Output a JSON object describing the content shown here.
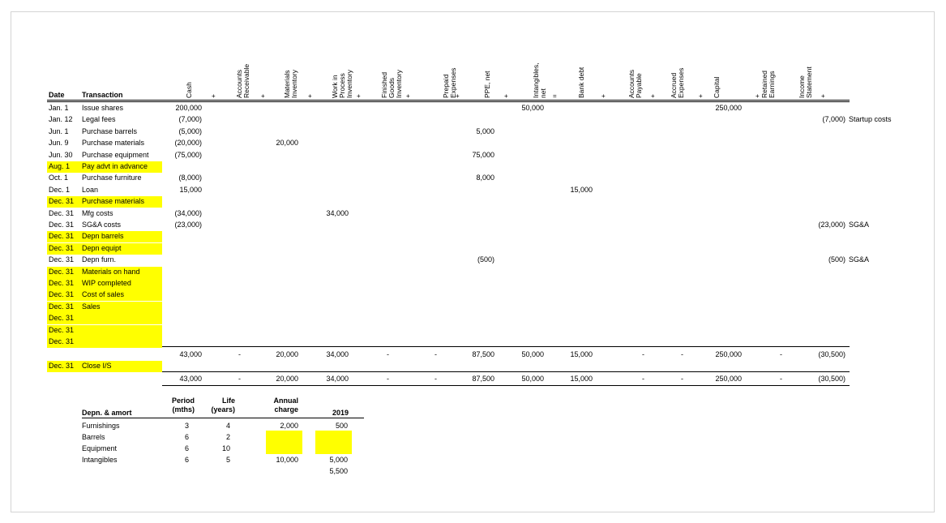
{
  "header": {
    "date": "Date",
    "transaction": "Transaction",
    "columns": [
      "Cash",
      "Accounts\nReceivable",
      "Materials\nInventory",
      "Work in\nProcess\nInventory",
      "Finished\nGoods\nInventory",
      "Prepaid\nExpenses",
      "PPE, net",
      "Intangibles,\nnet",
      "Bank debt",
      "Accounts\nPayable",
      "Accrued\nExpenses",
      "Capital",
      "Retained\nEarnings",
      "Income\nStatement"
    ],
    "operators": [
      "+",
      "+",
      "+",
      "+",
      "+",
      "+",
      "+",
      "=",
      "+",
      "+",
      "+",
      "+",
      "+"
    ]
  },
  "rows": [
    {
      "date": "Jan. 1",
      "tx": "Issue shares",
      "cash": "200,000",
      "intangibles": "50,000",
      "capital": "250,000"
    },
    {
      "date": "Jan. 12",
      "tx": "Legal fees",
      "cash": "(7,000)",
      "income": "(7,000)",
      "note": "Startup costs"
    },
    {
      "date": "Jun. 1",
      "tx": "Purchase barrels",
      "cash": "(5,000)",
      "ppe": "5,000"
    },
    {
      "date": "Jun. 9",
      "tx": "Purchase materials",
      "cash": "(20,000)",
      "materials": "20,000"
    },
    {
      "date": "Jun. 30",
      "tx": "Purchase equipment",
      "cash": "(75,000)",
      "ppe": "75,000"
    },
    {
      "date": "Aug. 1",
      "tx": "Pay advt in advance",
      "hl": true
    },
    {
      "date": "Oct. 1",
      "tx": "Purchase furniture",
      "cash": "(8,000)",
      "ppe": "8,000"
    },
    {
      "date": "Dec. 1",
      "tx": "Loan",
      "cash": "15,000",
      "bank": "15,000"
    },
    {
      "date": "Dec. 31",
      "tx": "Purchase materials",
      "hl": true
    },
    {
      "date": "Dec. 31",
      "tx": "Mfg costs",
      "cash": "(34,000)",
      "wip": "34,000"
    },
    {
      "date": "Dec. 31",
      "tx": "SG&A costs",
      "cash": "(23,000)",
      "income": "(23,000)",
      "note": "SG&A"
    },
    {
      "date": "Dec. 31",
      "tx": "Depn barrels",
      "hl": true
    },
    {
      "date": "Dec. 31",
      "tx": "Depn equipt",
      "hl": true
    },
    {
      "date": "Dec. 31",
      "tx": "Depn furn.",
      "ppe": "(500)",
      "income": "(500)",
      "note": "SG&A"
    },
    {
      "date": "Dec. 31",
      "tx": "Materials on hand",
      "hl": true
    },
    {
      "date": "Dec. 31",
      "tx": "WIP completed",
      "hl": true
    },
    {
      "date": "Dec. 31",
      "tx": "Cost of sales",
      "hl": true
    },
    {
      "date": "Dec. 31",
      "tx": "Sales",
      "hl": true
    },
    {
      "date": "Dec. 31",
      "tx": "",
      "hl": true
    },
    {
      "date": "Dec. 31",
      "tx": "",
      "hl": true
    },
    {
      "date": "Dec. 31",
      "tx": "",
      "hl": true
    }
  ],
  "totals": {
    "cash": "43,000",
    "ar": "-",
    "materials": "20,000",
    "wip": "34,000",
    "fg": "-",
    "prepaid": "-",
    "ppe": "87,500",
    "intangibles": "50,000",
    "bank": "15,000",
    "ap": "-",
    "accrued": "-",
    "capital": "250,000",
    "re": "-",
    "income": "(30,500)"
  },
  "close_row": {
    "date": "Dec. 31",
    "tx": "Close I/S"
  },
  "final_totals": {
    "cash": "43,000",
    "ar": "-",
    "materials": "20,000",
    "wip": "34,000",
    "fg": "-",
    "prepaid": "-",
    "ppe": "87,500",
    "intangibles": "50,000",
    "bank": "15,000",
    "ap": "-",
    "accrued": "-",
    "capital": "250,000",
    "re": "-",
    "income": "(30,500)"
  },
  "depn_table": {
    "headers": {
      "label": "Depn. & amort",
      "period": "Period\n(mths)",
      "life": "Life\n(years)",
      "annual": "Annual\ncharge",
      "year": "2019"
    },
    "rows": [
      {
        "label": "Furnishings",
        "period": "3",
        "life": "4",
        "annual": "2,000",
        "year": "500"
      },
      {
        "label": "Barrels",
        "period": "6",
        "life": "2",
        "annual": "",
        "year": "",
        "hl": true
      },
      {
        "label": "Equipment",
        "period": "6",
        "life": "10",
        "annual": "",
        "year": ""
      },
      {
        "label": "Intangibles",
        "period": "6",
        "life": "5",
        "annual": "10,000",
        "year": "5,000"
      }
    ],
    "total": "5,500"
  },
  "colors": {
    "highlight": "#ffff00",
    "border": "#d4d4d4"
  }
}
